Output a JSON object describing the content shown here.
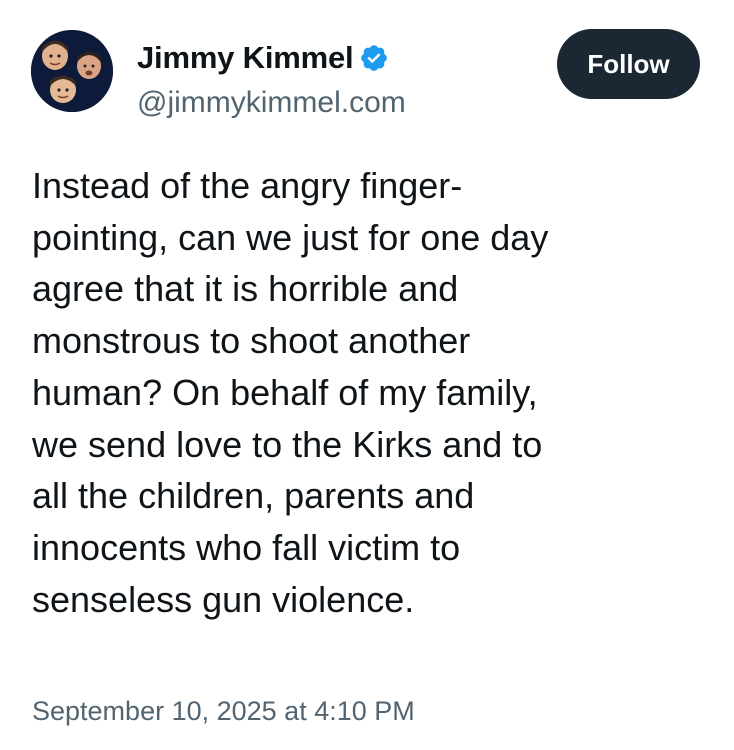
{
  "post": {
    "author": {
      "display_name": "Jimmy Kimmel",
      "handle": "@jimmykimmel.com",
      "verified_icon": "verified-check-icon",
      "avatar": "profile-photo"
    },
    "follow_label": "Follow",
    "text": "Instead of the angry finger-\npointing, can we just for one day\nagree that it is horrible and\nmonstrous to shoot another\nhuman? On behalf of my family,\nwe send love to the Kirks and to\nall the children, parents and\ninnocents who fall victim to\nsenseless gun violence.",
    "timestamp": "September 10, 2025 at 4:10 PM"
  },
  "colors": {
    "text_primary": "#0f1419",
    "text_secondary": "#536471",
    "follow_button_bg": "#1b2733",
    "verified_blue": "#1d9bf0"
  }
}
